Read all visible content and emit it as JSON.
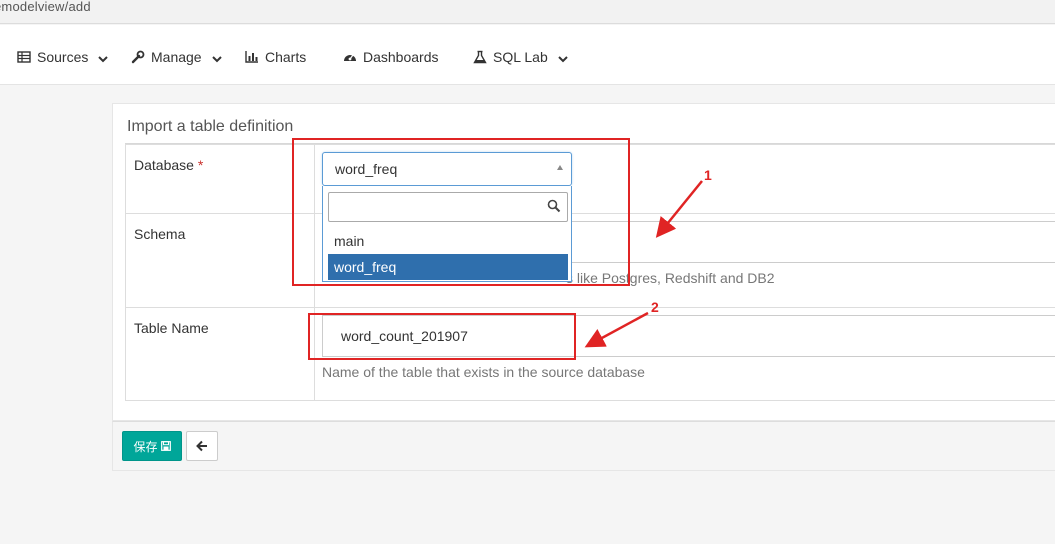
{
  "url": {
    "text": "emodelview/add"
  },
  "nav": {
    "items": [
      {
        "label": "Sources",
        "icon": "table-icon",
        "dropdown": true
      },
      {
        "label": "Manage",
        "icon": "wrench-icon",
        "dropdown": true
      },
      {
        "label": "Charts",
        "icon": "bar-chart-icon",
        "dropdown": false
      },
      {
        "label": "Dashboards",
        "icon": "dashboard-icon",
        "dropdown": false
      },
      {
        "label": "SQL Lab",
        "icon": "flask-icon",
        "dropdown": true
      }
    ]
  },
  "form": {
    "title": "Import a table definition",
    "database": {
      "label": "Database",
      "required_mark": "*",
      "selected": "word_freq",
      "search_value": "",
      "options": [
        "main",
        "word_freq"
      ],
      "active_option": "word_freq"
    },
    "schema": {
      "label": "Schema",
      "help_partial": "s like Postgres, Redshift and DB2"
    },
    "table_name": {
      "label": "Table Name",
      "value": "word_count_201907",
      "help": "Name of the table that exists in the source database"
    }
  },
  "footer": {
    "save_label": "保存",
    "back_icon": "arrow-left-icon"
  },
  "annotations": {
    "label_1": "1",
    "label_2": "2",
    "color": "#e02424"
  },
  "colors": {
    "primary": "#00a699",
    "selected_option": "#2f6fad",
    "required": "#c9302c"
  }
}
